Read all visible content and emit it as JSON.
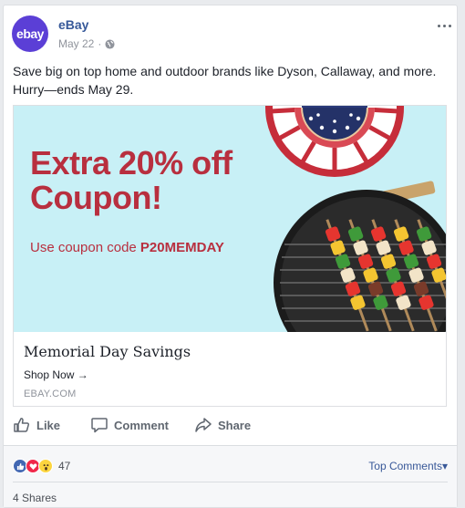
{
  "post": {
    "page_name": "eBay",
    "avatar_text": "ebay",
    "date": "May 22",
    "meta_separator": "·",
    "text": "Save big on top home and outdoor brands like Dyson, Callaway, and more. Hurry—ends May 29."
  },
  "ad": {
    "headline_line1": "Extra 20% off",
    "headline_line2": "Coupon!",
    "coupon_prefix": "Use coupon code ",
    "coupon_code": "P20MEMDAY",
    "title": "Memorial Day Savings",
    "cta": "Shop Now →",
    "domain": "EBAY.COM"
  },
  "actions": {
    "like": "Like",
    "comment": "Comment",
    "share": "Share"
  },
  "stats": {
    "reaction_count": "47",
    "top_comments": "Top Comments▾",
    "shares": "4 Shares"
  },
  "colors": {
    "brand_link": "#365899",
    "ad_background": "#c8f0f6",
    "headline_red": "#b82f3f",
    "avatar_purple": "#5b3fd6"
  },
  "icons": [
    "globe-icon",
    "more-icon",
    "like-icon",
    "comment-icon",
    "share-icon",
    "like-reaction-icon",
    "love-reaction-icon",
    "wow-reaction-icon"
  ]
}
